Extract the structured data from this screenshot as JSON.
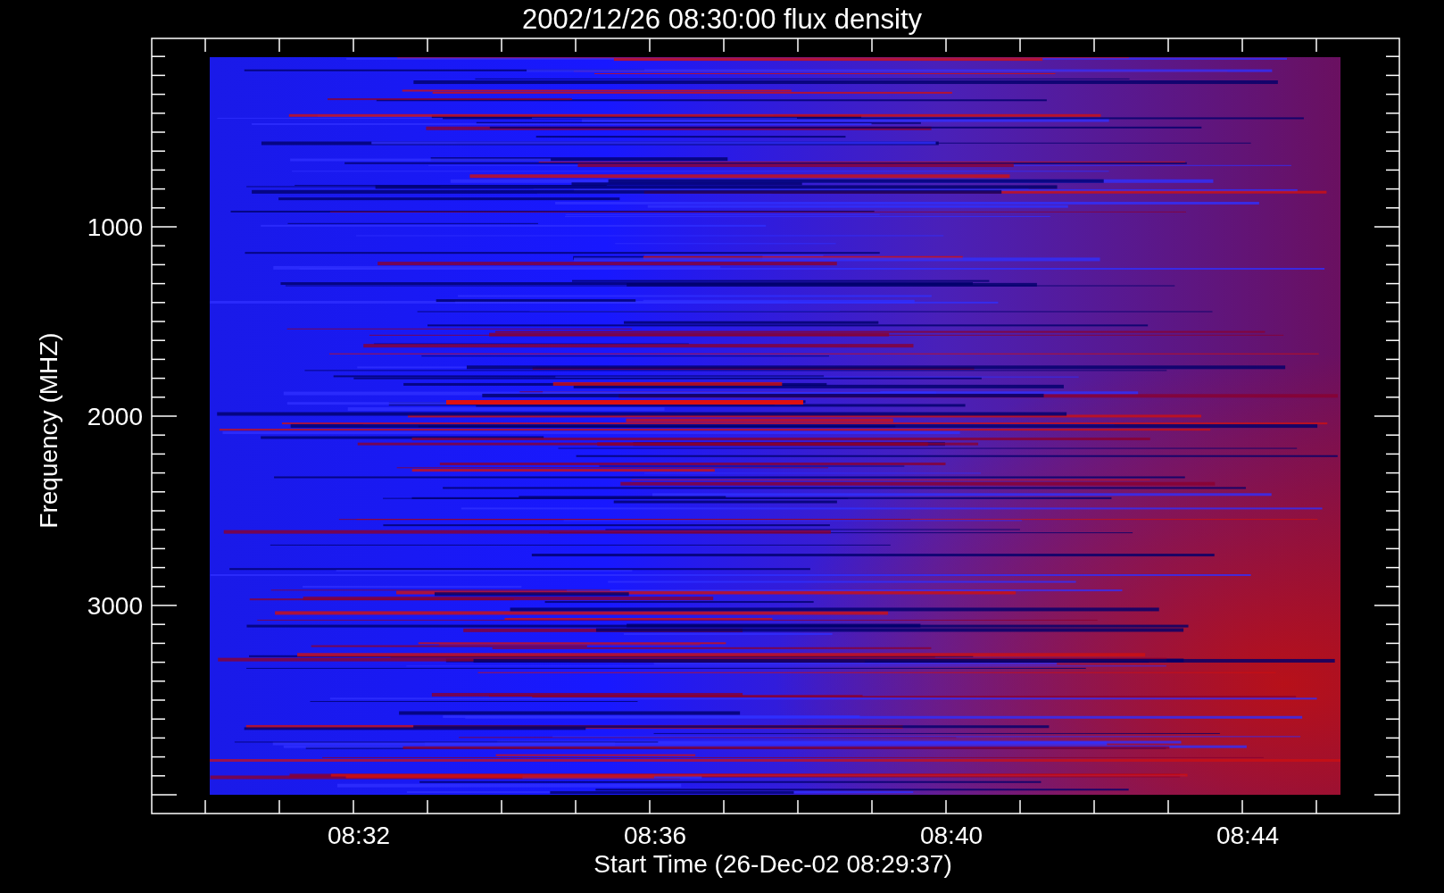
{
  "plot": {
    "title": "2002/12/26 08:30:00 flux density",
    "ylabel": "Frequency (MHZ)",
    "xlabel": "Start Time (26-Dec-02 08:29:37)",
    "yticks": [
      "1000",
      "2000",
      "3000"
    ],
    "xticks": [
      "08:32",
      "08:36",
      "08:40",
      "08:44"
    ]
  }
}
